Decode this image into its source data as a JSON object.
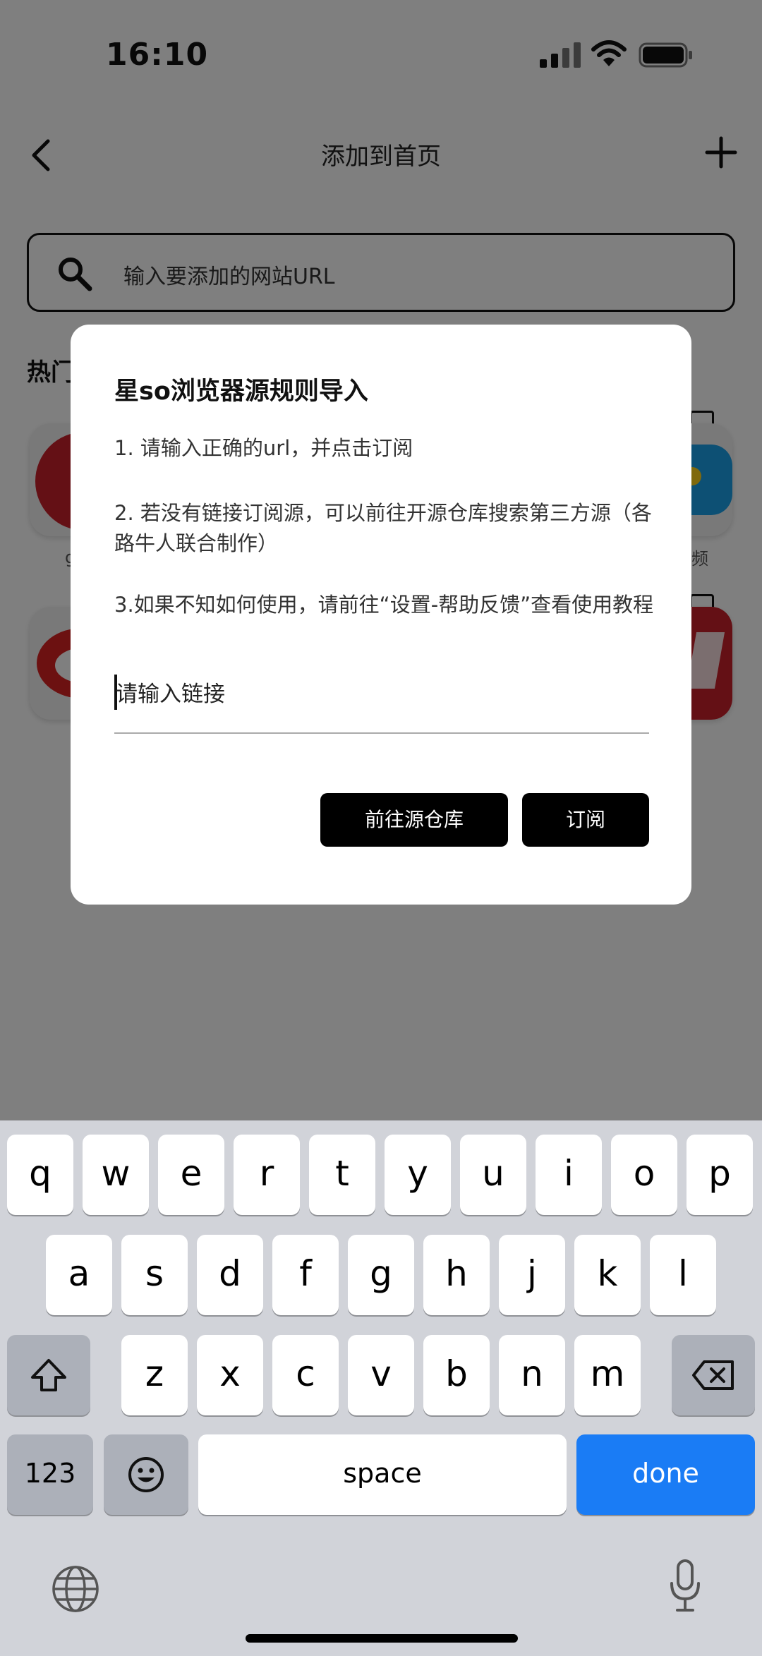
{
  "status_bar": {
    "time": "16:10"
  },
  "nav": {
    "title": "添加到首页"
  },
  "search": {
    "placeholder": "输入要添加的网站URL"
  },
  "section": {
    "title": "热门"
  },
  "tiles": {
    "label_right_1": "频",
    "label_left_1": "g"
  },
  "dialog": {
    "title": "星so浏览器源规则导入",
    "p1": "1. 请输入正确的url，并点击订阅",
    "p2": "2. 若没有链接订阅源，可以前往开源仓库搜索第三方源（各路牛人联合制作）",
    "p3": "3.如果不知如何使用，请前往“设置-帮助反馈”查看使用教程",
    "input_placeholder": "请输入链接",
    "repo_button": "前往源仓库",
    "subscribe_button": "订阅"
  },
  "keyboard": {
    "row1": [
      "q",
      "w",
      "e",
      "r",
      "t",
      "y",
      "u",
      "i",
      "o",
      "p"
    ],
    "row2": [
      "a",
      "s",
      "d",
      "f",
      "g",
      "h",
      "j",
      "k",
      "l"
    ],
    "row3": [
      "z",
      "x",
      "c",
      "v",
      "b",
      "n",
      "m"
    ],
    "numbers_key": "123",
    "space_key": "space",
    "done_key": "done"
  },
  "colors": {
    "accent_blue": "#1a7cf5",
    "overlay": "rgba(0,0,0,0.5)",
    "tile_red": "#c8202a"
  }
}
